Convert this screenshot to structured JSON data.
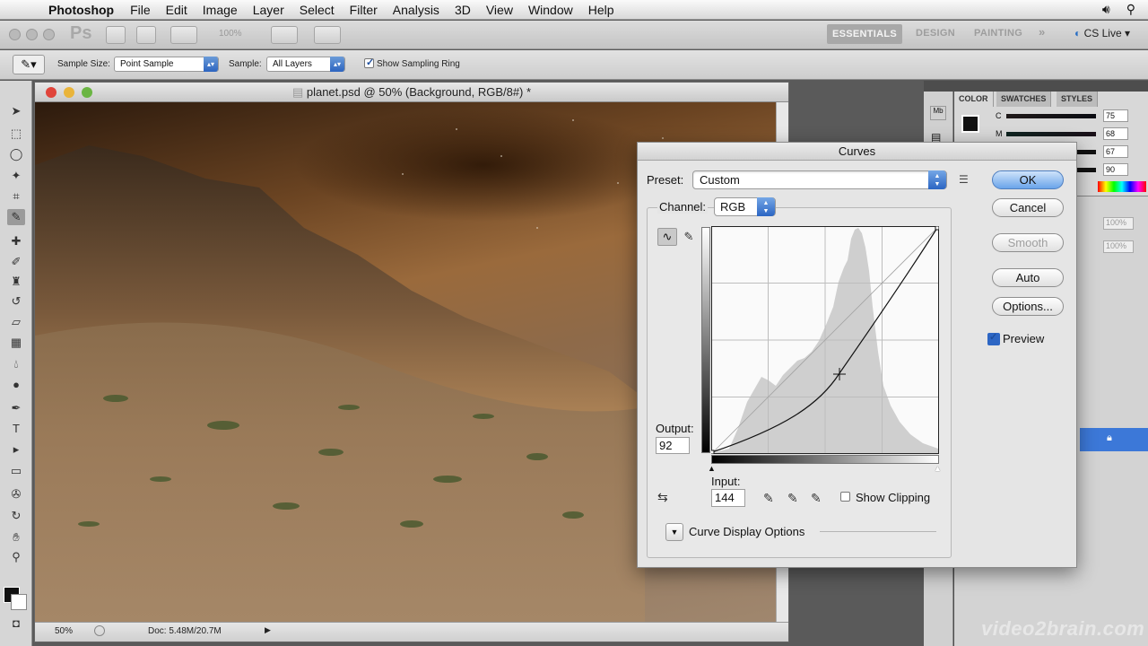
{
  "menubar": {
    "app_name": "Photoshop",
    "items": [
      "File",
      "Edit",
      "Image",
      "Layer",
      "Select",
      "Filter",
      "Analysis",
      "3D",
      "View",
      "Window",
      "Help"
    ]
  },
  "appbar": {
    "logo": "Ps",
    "zoom": "100%",
    "workspaces": [
      "ESSENTIALS",
      "DESIGN",
      "PAINTING"
    ],
    "cslive": "CS Live"
  },
  "options": {
    "sample_size_label": "Sample Size:",
    "sample_size_value": "Point Sample",
    "sample_label": "Sample:",
    "sample_value": "All Layers",
    "show_ring_label": "Show Sampling Ring",
    "show_ring_checked": true
  },
  "document": {
    "title": "planet.psd @ 50% (Background, RGB/8#) *",
    "zoom": "50%",
    "doc_info": "Doc: 5.48M/20.7M"
  },
  "color_panel": {
    "tabs": [
      "COLOR",
      "SWATCHES",
      "STYLES"
    ],
    "channels": [
      {
        "label": "C",
        "value": "75"
      },
      {
        "label": "M",
        "value": "68"
      },
      {
        "label": "",
        "value": "67"
      },
      {
        "label": "",
        "value": "90"
      }
    ]
  },
  "layers_panel": {
    "opacity": "100%",
    "fill": "100%"
  },
  "curves": {
    "title": "Curves",
    "preset_label": "Preset:",
    "preset_value": "Custom",
    "channel_label": "Channel:",
    "channel_value": "RGB",
    "output_label": "Output:",
    "output_value": "92",
    "input_label": "Input:",
    "input_value": "144",
    "show_clipping_label": "Show Clipping",
    "show_clipping_checked": false,
    "display_options_label": "Curve Display Options",
    "buttons": {
      "ok": "OK",
      "cancel": "Cancel",
      "smooth": "Smooth",
      "auto": "Auto",
      "options": "Options..."
    },
    "preview_label": "Preview",
    "preview_checked": true
  },
  "watermark": "video2brain.com"
}
